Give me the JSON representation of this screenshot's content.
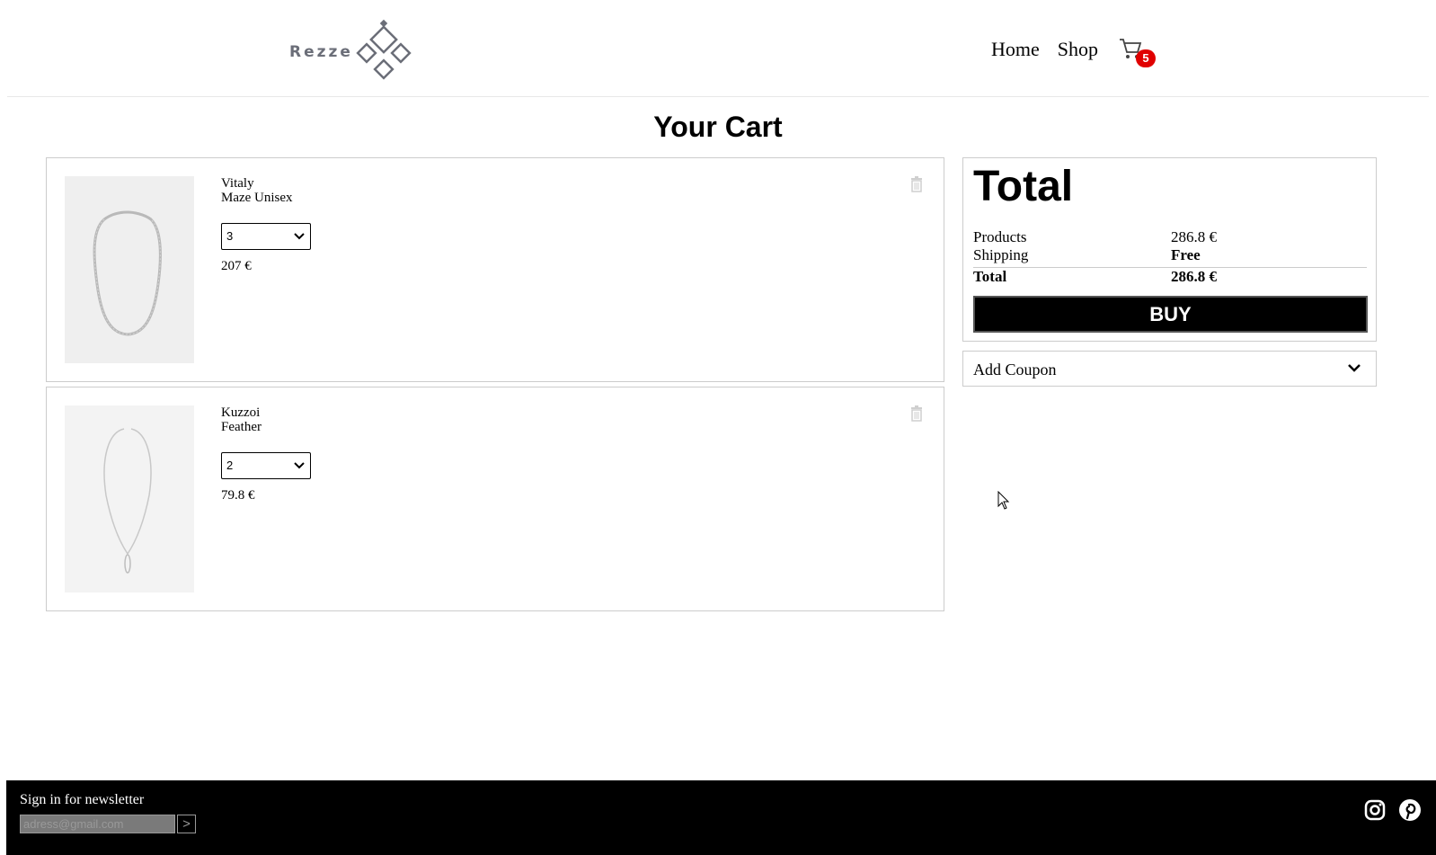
{
  "header": {
    "logo_text": "Rezze",
    "nav": [
      {
        "label": "Home"
      },
      {
        "label": "Shop"
      }
    ],
    "cart_count": "5"
  },
  "page_title": "Your Cart",
  "items": [
    {
      "brand": "Vitaly",
      "model": "Maze Unisex",
      "quantity": "3",
      "price": "207 €"
    },
    {
      "brand": "Kuzzoi",
      "model": "Feather",
      "quantity": "2",
      "price": "79.8 €"
    }
  ],
  "summary": {
    "heading": "Total",
    "products_label": "Products",
    "products_value": "286.8 €",
    "shipping_label": "Shipping",
    "shipping_value": "Free",
    "total_label": "Total",
    "total_value": "286.8 €",
    "buy_label": "BUY"
  },
  "coupon": {
    "label": "Add Coupon"
  },
  "footer": {
    "newsletter_label": "Sign in for newsletter",
    "email_placeholder": "adress@gmail.com",
    "submit_label": ">"
  },
  "colors": {
    "badge": "#e00000",
    "logo": "#6b6e78",
    "footer_bg": "#000000",
    "buy_bg": "#000000"
  },
  "icons": [
    "cart-icon",
    "trash-icon",
    "chevron-down-icon",
    "instagram-icon",
    "pinterest-icon",
    "mouse-cursor-icon"
  ]
}
